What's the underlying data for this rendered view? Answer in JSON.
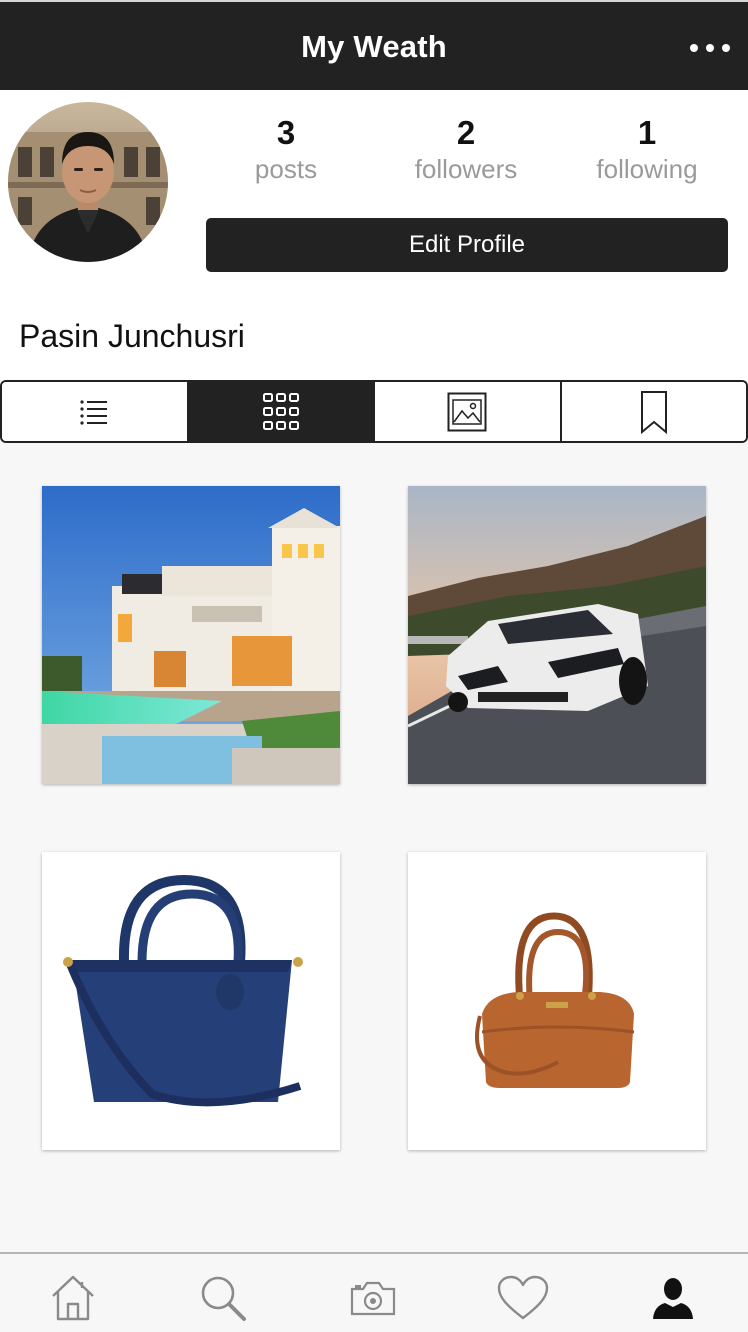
{
  "header": {
    "title": "My Weath"
  },
  "profile": {
    "name": "Pasin Junchusri",
    "stats": [
      {
        "value": "3",
        "label": "posts"
      },
      {
        "value": "2",
        "label": "followers"
      },
      {
        "value": "1",
        "label": "following"
      }
    ],
    "edit_button_label": "Edit Profile"
  },
  "tabs": [
    {
      "icon": "list-icon",
      "active": false
    },
    {
      "icon": "grid-icon",
      "active": true
    },
    {
      "icon": "image-icon",
      "active": false
    },
    {
      "icon": "bookmark-icon",
      "active": false
    }
  ],
  "posts": [
    {
      "subject": "villa-with-pool"
    },
    {
      "subject": "white-sports-car"
    },
    {
      "subject": "navy-handbag"
    },
    {
      "subject": "brown-handbag"
    }
  ],
  "bottom_nav": [
    {
      "icon": "home-icon",
      "active": false
    },
    {
      "icon": "search-icon",
      "active": false
    },
    {
      "icon": "camera-icon",
      "active": false
    },
    {
      "icon": "heart-icon",
      "active": false
    },
    {
      "icon": "profile-icon",
      "active": true
    }
  ],
  "colors": {
    "header_bg": "#222222",
    "header_text": "#ffffff",
    "muted_text": "#9a9a9a",
    "page_bg": "#f7f7f7",
    "nav_icon": "#8a8a8a",
    "nav_icon_active": "#111111"
  }
}
